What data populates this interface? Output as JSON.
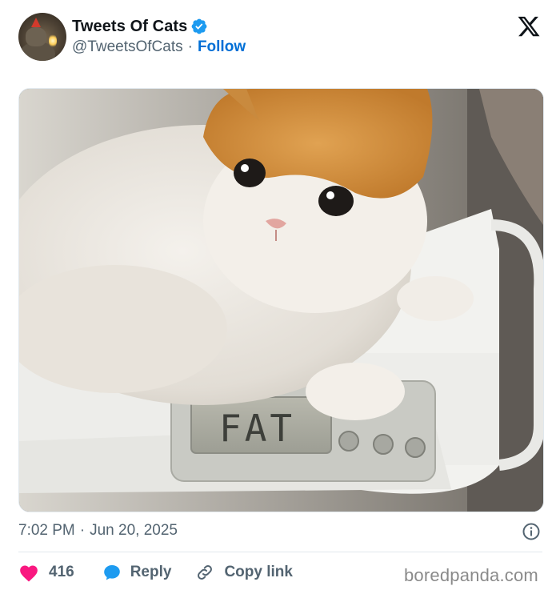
{
  "tweet": {
    "author": {
      "display_name": "Tweets Of Cats",
      "handle": "@TweetsOfCats",
      "verified": true,
      "follow_label": "Follow",
      "separator": "·"
    },
    "platform_logo": "x-logo-icon",
    "media": {
      "description_icon": "photo-cat-on-scale",
      "scale_display_text": "FAT"
    },
    "timestamp": {
      "time": "7:02 PM",
      "separator": "·",
      "date": "Jun 20, 2025"
    },
    "actions": {
      "like_count": "416",
      "reply_label": "Reply",
      "copy_link_label": "Copy link"
    }
  },
  "watermark": "boredpanda.com",
  "colors": {
    "link_blue": "#006fd6",
    "verified_blue": "#1d9bf0",
    "heart_pink": "#f91880",
    "secondary_text": "#536471",
    "primary_text": "#0f1419"
  }
}
